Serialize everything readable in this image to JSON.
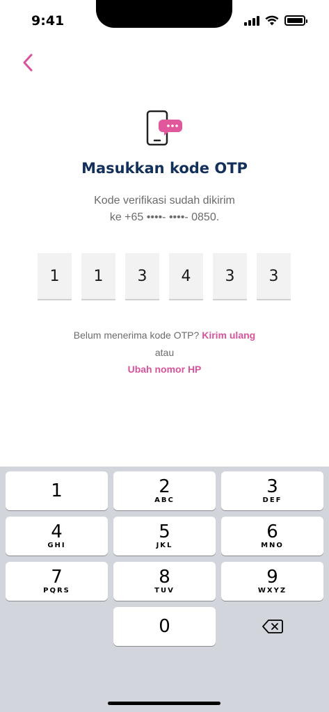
{
  "status_bar": {
    "time": "9:41"
  },
  "header": {
    "back_icon": "chevron-left-icon"
  },
  "illustration": {
    "icon": "phone-chat-icon",
    "accent_color": "#e0579c"
  },
  "title": "Masukkan kode OTP",
  "subtitle": {
    "line1": "Kode verifikasi sudah dikirim",
    "line2": "ke +65 ••••- ••••- 0850."
  },
  "otp": {
    "digits": [
      "1",
      "1",
      "3",
      "4",
      "3",
      "3"
    ]
  },
  "resend": {
    "prompt": "Belum menerima kode OTP?",
    "link": "Kirim ulang"
  },
  "or_text": "atau",
  "change_number_link": "Ubah nomor HP",
  "keyboard": {
    "keys": [
      {
        "digit": "1",
        "letters": ""
      },
      {
        "digit": "2",
        "letters": "ABC"
      },
      {
        "digit": "3",
        "letters": "DEF"
      },
      {
        "digit": "4",
        "letters": "GHI"
      },
      {
        "digit": "5",
        "letters": "JKL"
      },
      {
        "digit": "6",
        "letters": "MNO"
      },
      {
        "digit": "7",
        "letters": "PQRS"
      },
      {
        "digit": "8",
        "letters": "TUV"
      },
      {
        "digit": "9",
        "letters": "WXYZ"
      },
      {
        "digit": "0",
        "letters": ""
      }
    ],
    "delete_icon": "backspace-icon"
  },
  "colors": {
    "title": "#13305b",
    "link": "#d9539a",
    "keyboard_bg": "#d2d5db"
  }
}
